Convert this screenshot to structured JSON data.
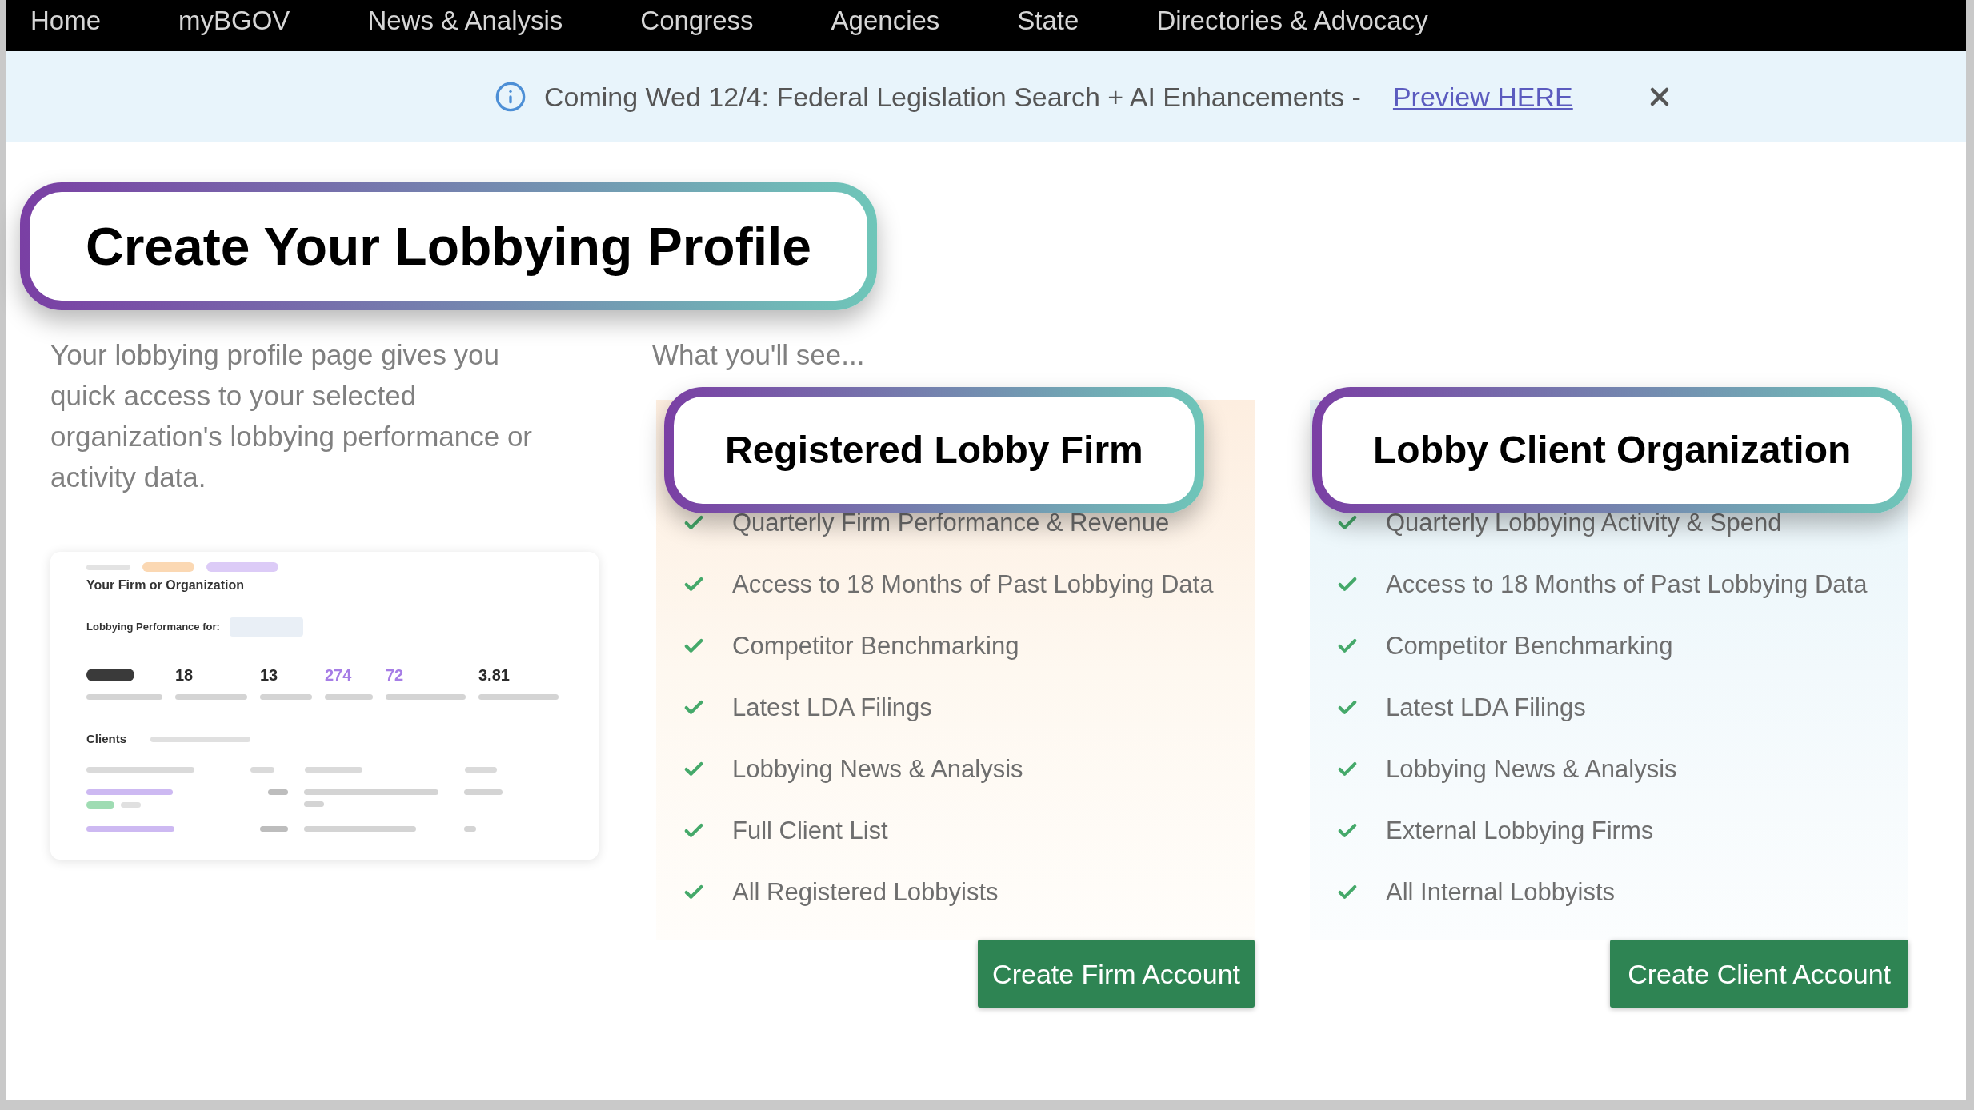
{
  "nav": {
    "items": [
      "Home",
      "myBGOV",
      "News & Analysis",
      "Congress",
      "Agencies",
      "State",
      "Directories & Advocacy"
    ]
  },
  "banner": {
    "text": "Coming Wed 12/4: Federal Legislation Search + AI Enhancements -",
    "link": "Preview HERE"
  },
  "heading_callout": "Create Your Lobbying Profile",
  "intro": "Your lobbying profile page gives you quick access to your selected organization's lobbying performance or activity data.",
  "preview": {
    "title": "Your Firm or Organization",
    "filter_label": "Lobbying Performance for:",
    "stats": [
      {
        "value": "18",
        "color": "#2b2b2b"
      },
      {
        "value": "13",
        "color": "#2b2b2b"
      },
      {
        "value": "274",
        "color": "#a67de6"
      },
      {
        "value": "72",
        "color": "#a67de6"
      },
      {
        "value": "3.81",
        "color": "#2b2b2b"
      }
    ],
    "section_title": "Clients"
  },
  "features_heading": "What you'll see...",
  "cards": [
    {
      "kind": "firm",
      "callout": "Registered Lobby Firm",
      "features": [
        "Quarterly Firm Performance & Revenue",
        "Access to 18 Months of Past Lobbying Data",
        "Competitor Benchmarking",
        "Latest LDA Filings",
        "Lobbying News & Analysis",
        "Full Client List",
        "All Registered Lobbyists"
      ],
      "button": "Create Firm Account"
    },
    {
      "kind": "client",
      "callout": "Lobby Client Organization",
      "features": [
        "Quarterly Lobbying Activity & Spend",
        "Access to 18 Months of Past Lobbying Data",
        "Competitor Benchmarking",
        "Latest LDA Filings",
        "Lobbying News & Analysis",
        "External Lobbying Firms",
        "All Internal Lobbyists"
      ],
      "button": "Create Client Account"
    }
  ]
}
